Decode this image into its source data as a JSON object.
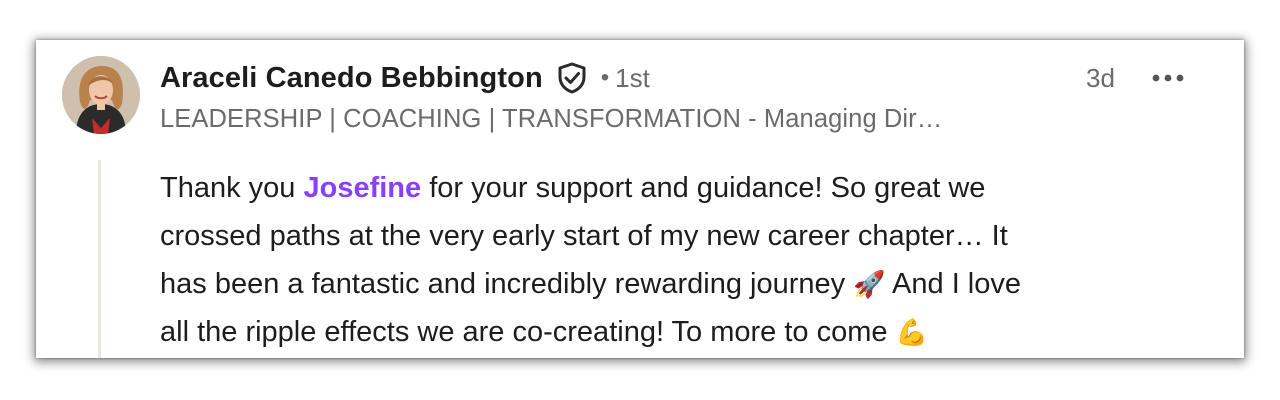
{
  "comment": {
    "author": {
      "name": "Araceli Canedo Bebbington",
      "connection_separator": "•",
      "connection_degree": "1st",
      "headline": "LEADERSHIP | COACHING | TRANSFORMATION - Managing Dir…",
      "verified_icon": "shield-check-icon",
      "avatar_icon": "profile-photo"
    },
    "timestamp": "3d",
    "more_icon": "ellipsis-icon",
    "text": {
      "line1_before": "Thank you ",
      "mention": "Josefine",
      "line1_after": " for your support and guidance! So great we",
      "line2": "crossed paths at the very early start of my new career chapter… It",
      "line3_before": "has been a fantastic and incredibly rewarding journey ",
      "emoji_rocket": "🚀",
      "line3_after": " And I love",
      "line4_before": "all the ripple effects we are co-creating! To more to come ",
      "emoji_muscle": "💪"
    },
    "colors": {
      "mention": "#8a3ffc",
      "text": "#1d1d1d",
      "muted": "#6b6b6b"
    }
  }
}
